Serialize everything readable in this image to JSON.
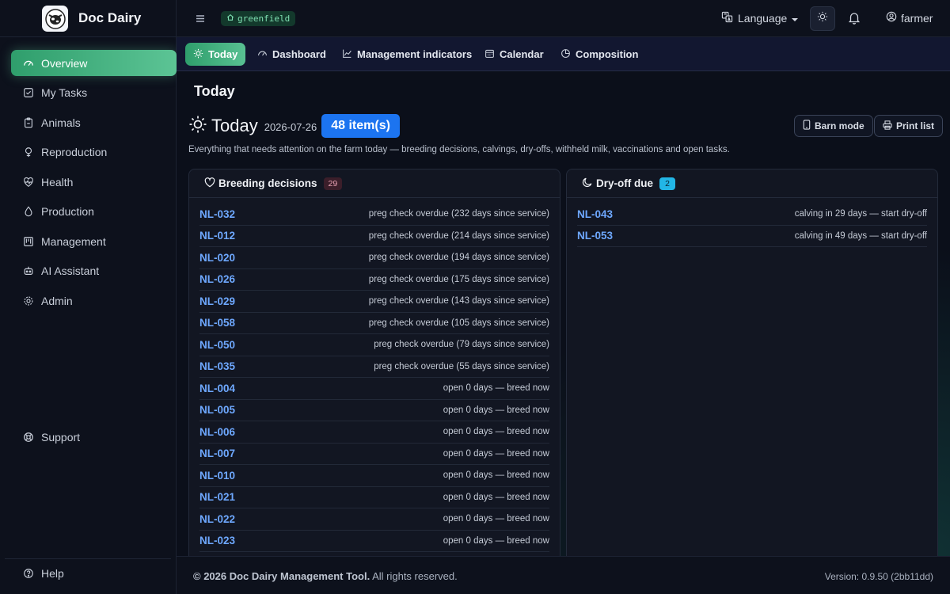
{
  "brand": {
    "title": "Doc Dairy"
  },
  "sidebar": {
    "items": [
      {
        "label": "Overview",
        "icon": "gauge-icon",
        "active": true
      },
      {
        "label": "My Tasks",
        "icon": "checkbox-icon"
      },
      {
        "label": "Animals",
        "icon": "clipboard-icon"
      },
      {
        "label": "Reproduction",
        "icon": "female-icon"
      },
      {
        "label": "Health",
        "icon": "heart-pulse-icon"
      },
      {
        "label": "Production",
        "icon": "droplet-icon"
      },
      {
        "label": "Management",
        "icon": "kanban-icon"
      },
      {
        "label": "AI Assistant",
        "icon": "robot-icon"
      },
      {
        "label": "Admin",
        "icon": "gear-icon"
      }
    ],
    "support": "Support",
    "help": "Help"
  },
  "topbar": {
    "farm": "greenfield",
    "language": "Language",
    "user": "farmer"
  },
  "tabs": [
    {
      "label": "Today",
      "icon": "sun-icon",
      "active": true
    },
    {
      "label": "Dashboard",
      "icon": "gauge-icon"
    },
    {
      "label": "Management indicators",
      "icon": "chart-line-icon"
    },
    {
      "label": "Calendar",
      "icon": "calendar-icon"
    },
    {
      "label": "Composition",
      "icon": "pie-chart-icon"
    }
  ],
  "main": {
    "page_title": "Today",
    "heading": "Today",
    "date": "2026-07-26",
    "count": "48 item(s)",
    "barn_mode": "Barn mode",
    "print_list": "Print list",
    "subtitle": "Everything that needs attention on the farm today — breeding decisions, calvings, dry-offs, withheld milk, vaccinations and open tasks."
  },
  "breeding": {
    "title": "Breeding decisions",
    "count": "29",
    "rows": [
      {
        "id": "NL-032",
        "info": "preg check overdue (232 days since service)"
      },
      {
        "id": "NL-012",
        "info": "preg check overdue (214 days since service)"
      },
      {
        "id": "NL-020",
        "info": "preg check overdue (194 days since service)"
      },
      {
        "id": "NL-026",
        "info": "preg check overdue (175 days since service)"
      },
      {
        "id": "NL-029",
        "info": "preg check overdue (143 days since service)"
      },
      {
        "id": "NL-058",
        "info": "preg check overdue (105 days since service)"
      },
      {
        "id": "NL-050",
        "info": "preg check overdue (79 days since service)"
      },
      {
        "id": "NL-035",
        "info": "preg check overdue (55 days since service)"
      },
      {
        "id": "NL-004",
        "info": "open 0 days — breed now"
      },
      {
        "id": "NL-005",
        "info": "open 0 days — breed now"
      },
      {
        "id": "NL-006",
        "info": "open 0 days — breed now"
      },
      {
        "id": "NL-007",
        "info": "open 0 days — breed now"
      },
      {
        "id": "NL-010",
        "info": "open 0 days — breed now"
      },
      {
        "id": "NL-021",
        "info": "open 0 days — breed now"
      },
      {
        "id": "NL-022",
        "info": "open 0 days — breed now"
      },
      {
        "id": "NL-023",
        "info": "open 0 days — breed now"
      }
    ]
  },
  "dryoff": {
    "title": "Dry-off due",
    "count": "2",
    "rows": [
      {
        "id": "NL-043",
        "info": "calving in 29 days — start dry-off"
      },
      {
        "id": "NL-053",
        "info": "calving in 49 days — start dry-off"
      }
    ]
  },
  "footer": {
    "copyright_bold": "© 2026 Doc Dairy Management Tool.",
    "copyright_rest": " All rights reserved.",
    "version": "Version: 0.9.50 (2bb11dd)"
  },
  "colors": {
    "accent": "#2f9e6c",
    "badge_blue": "#1c74f0",
    "link": "#6ea8ff"
  }
}
